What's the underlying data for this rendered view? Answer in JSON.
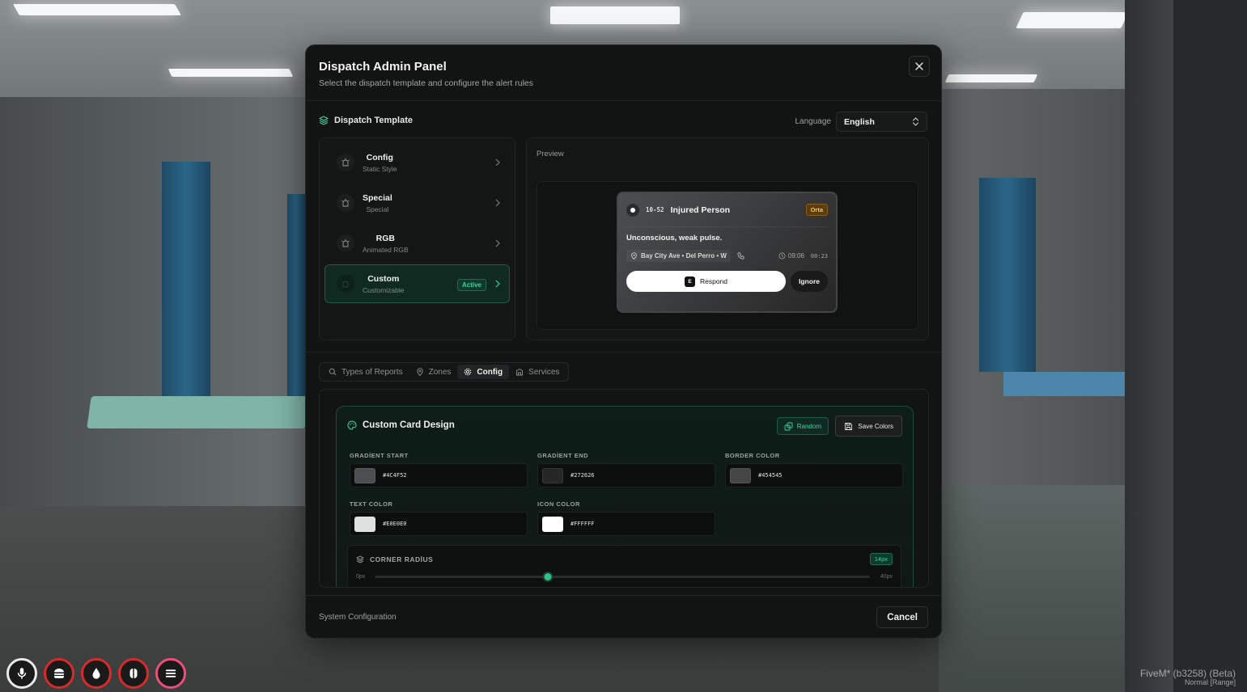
{
  "panel": {
    "title": "Dispatch Admin Panel",
    "subtitle": "Select the dispatch template and configure the alert rules"
  },
  "template_section": {
    "label": "Dispatch Template",
    "language_label": "Language",
    "language_value": "English"
  },
  "templates": [
    {
      "name": "Config",
      "desc": "Static Style",
      "active": false
    },
    {
      "name": "Special",
      "desc": "Special",
      "active": false
    },
    {
      "name": "RGB",
      "desc": "Animated RGB",
      "active": false
    },
    {
      "name": "Custom",
      "desc": "Customizable",
      "active": true,
      "badge": "Active"
    }
  ],
  "preview": {
    "label": "Preview",
    "card": {
      "code": "10-52",
      "title": "Injured Person",
      "priority": "Orta",
      "description": "Unconscious, weak pulse.",
      "location": "Bay City Ave • Del Perro • W",
      "time": "09:06",
      "timer": "00:23",
      "respond_key": "E",
      "respond_label": "Respond",
      "ignore_label": "Ignore"
    }
  },
  "tabs": [
    {
      "label": "Types of Reports",
      "icon": "search-icon",
      "active": false
    },
    {
      "label": "Zones",
      "icon": "map-pin-icon",
      "active": false
    },
    {
      "label": "Config",
      "icon": "gear-icon",
      "active": true
    },
    {
      "label": "Services",
      "icon": "building-icon",
      "active": false
    }
  ],
  "design": {
    "title": "Custom Card Design",
    "random_label": "Random",
    "save_label": "Save Colors",
    "fields": [
      {
        "label": "GRADİENT START",
        "value": "#4C4F52",
        "color": "#4C4F52"
      },
      {
        "label": "GRADİENT END",
        "value": "#272626",
        "color": "#272626"
      },
      {
        "label": "BORDER COLOR",
        "value": "#454545",
        "color": "#454545"
      },
      {
        "label": "TEXT COLOR",
        "value": "#E0E0E0",
        "color": "#E0E0E0"
      },
      {
        "label": "ICON COLOR",
        "value": "#FFFFFF",
        "color": "#FFFFFF"
      }
    ],
    "corner_radius": {
      "label": "CORNER RADİUS",
      "value_label": "14px",
      "min_label": "0px",
      "max_label": "40px",
      "value": 14,
      "min": 0,
      "max": 40
    }
  },
  "footer": {
    "text": "System Configuration",
    "cancel_label": "Cancel"
  },
  "watermark": {
    "line1": "FiveM* (b3258) (Beta)",
    "line2": "Normal [Range]"
  },
  "colors": {
    "accent": "#2FBF87",
    "active_bg": "#102A22",
    "priority": "#F2C46A"
  },
  "hud": [
    {
      "icon": "microphone-icon",
      "ring": "white"
    },
    {
      "icon": "burger-icon",
      "ring": "red"
    },
    {
      "icon": "water-drop-icon",
      "ring": "red"
    },
    {
      "icon": "brain-icon",
      "ring": "red"
    },
    {
      "icon": "menu-icon",
      "ring": "pink"
    }
  ]
}
